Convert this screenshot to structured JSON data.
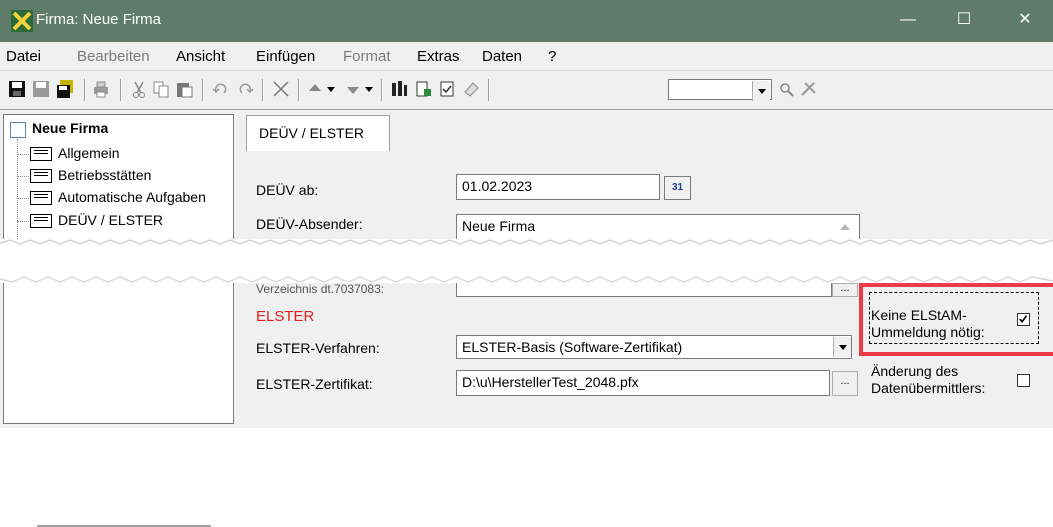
{
  "window": {
    "title": "Firma: Neue Firma"
  },
  "window_buttons": {
    "minimize": "—",
    "maximize": "☐",
    "close": "✕"
  },
  "menu": [
    {
      "label": "Datei",
      "enabled": true
    },
    {
      "label": "Bearbeiten",
      "enabled": false
    },
    {
      "label": "Ansicht",
      "enabled": true
    },
    {
      "label": "Einfügen",
      "enabled": true
    },
    {
      "label": "Format",
      "enabled": false
    },
    {
      "label": "Extras",
      "enabled": true
    },
    {
      "label": "Daten",
      "enabled": true
    },
    {
      "label": "?",
      "enabled": true
    }
  ],
  "toolbar": {
    "icons": [
      "save-icon",
      "save-as-icon",
      "save-all-icon",
      "print-icon",
      "cut-icon",
      "copy-icon",
      "paste-icon",
      "undo-icon",
      "redo-icon",
      "delete-icon",
      "move-up-icon",
      "move-down-icon",
      "columns-icon",
      "new-page-icon",
      "checklist-icon",
      "eraser-icon",
      "zoom-icon",
      "tools-icon"
    ],
    "combo_value": ""
  },
  "tree": {
    "root": "Neue Firma",
    "items": [
      "Allgemein",
      "Betriebsstätten",
      "Automatische Aufgaben",
      "DEÜV / ELSTER"
    ]
  },
  "tab": {
    "label": "DEÜV / ELSTER"
  },
  "form": {
    "deuev_ab_label": "DEÜV ab:",
    "deuev_ab_value": "01.02.2023",
    "calendar_label": "31",
    "deuev_absender_label": "DEÜV-Absender:",
    "deuev_absender_value": "Neue Firma",
    "verzeichnis_label": "Verzeichnis dt.7037083:",
    "browse_label": "...",
    "elster_heading": "ELSTER",
    "elster_verfahren_label": "ELSTER-Verfahren:",
    "elster_verfahren_value": "ELSTER-Basis (Software-Zertifikat)",
    "elster_zertifikat_label": "ELSTER-Zertifikat:",
    "elster_zertifikat_value": "D:\\u\\HerstellerTest_2048.pfx",
    "keine_elstam_label_line1": "Keine ELStAM-",
    "keine_elstam_label_line2": "Ummeldung nötig:",
    "keine_elstam_checked": true,
    "aenderung_label_line1": "Änderung des",
    "aenderung_label_line2": "Datenübermittlers:",
    "aenderung_checked": false
  },
  "colors": {
    "titlebar": "#5f7c6b",
    "elster_heading": "#e02020",
    "highlight": "#ee3a46"
  }
}
